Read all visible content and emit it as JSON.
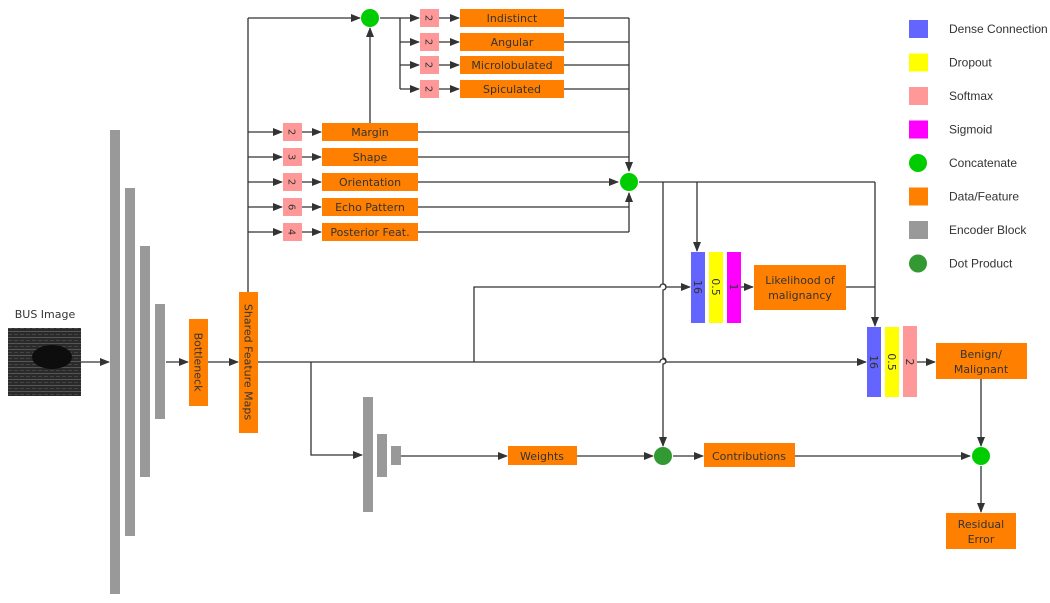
{
  "colors": {
    "dense": "#6464ff",
    "dropout": "#ffff00",
    "softmax": "#ff9999",
    "sigmoid": "#ff00ff",
    "concat": "#00cc00",
    "data": "#ff8000",
    "encoder": "#999999",
    "dot": "#339933",
    "line": "#333333",
    "text": "#333333"
  },
  "input": {
    "label": "BUS Image"
  },
  "bottleneck": {
    "label": "Bottleneck"
  },
  "shared": {
    "label": "Shared Feature Maps"
  },
  "margin_sub": [
    {
      "softmax": "2",
      "label": "Indistinct"
    },
    {
      "softmax": "2",
      "label": "Angular"
    },
    {
      "softmax": "2",
      "label": "Microlobulated"
    },
    {
      "softmax": "2",
      "label": "Spiculated"
    }
  ],
  "features": [
    {
      "softmax": "2",
      "label": "Margin"
    },
    {
      "softmax": "3",
      "label": "Shape"
    },
    {
      "softmax": "2",
      "label": "Orientation"
    },
    {
      "softmax": "6",
      "label": "Echo Pattern"
    },
    {
      "softmax": "4",
      "label": "Posterior Feat."
    }
  ],
  "likelihood_head": {
    "dense": "16",
    "dropout": "0.5",
    "sigmoid": "1",
    "output": [
      "Likelihood of",
      "malignancy"
    ]
  },
  "classifier_head": {
    "dense": "16",
    "dropout": "0.5",
    "softmax": "2",
    "output": [
      "Benign/",
      "Malignant"
    ]
  },
  "weights": {
    "label": "Weights"
  },
  "contributions": {
    "label": "Contributions"
  },
  "residual": {
    "label": [
      "Residual",
      "Error"
    ]
  },
  "legend": [
    {
      "label": "Dense Connection",
      "shape": "square",
      "color_key": "dense"
    },
    {
      "label": "Dropout",
      "shape": "square",
      "color_key": "dropout"
    },
    {
      "label": "Softmax",
      "shape": "square",
      "color_key": "softmax"
    },
    {
      "label": "Sigmoid",
      "shape": "square",
      "color_key": "sigmoid"
    },
    {
      "label": "Concatenate",
      "shape": "circle",
      "color_key": "concat"
    },
    {
      "label": "Data/Feature",
      "shape": "square",
      "color_key": "data"
    },
    {
      "label": "Encoder Block",
      "shape": "square",
      "color_key": "encoder"
    },
    {
      "label": "Dot Product",
      "shape": "circle",
      "color_key": "dot"
    }
  ]
}
